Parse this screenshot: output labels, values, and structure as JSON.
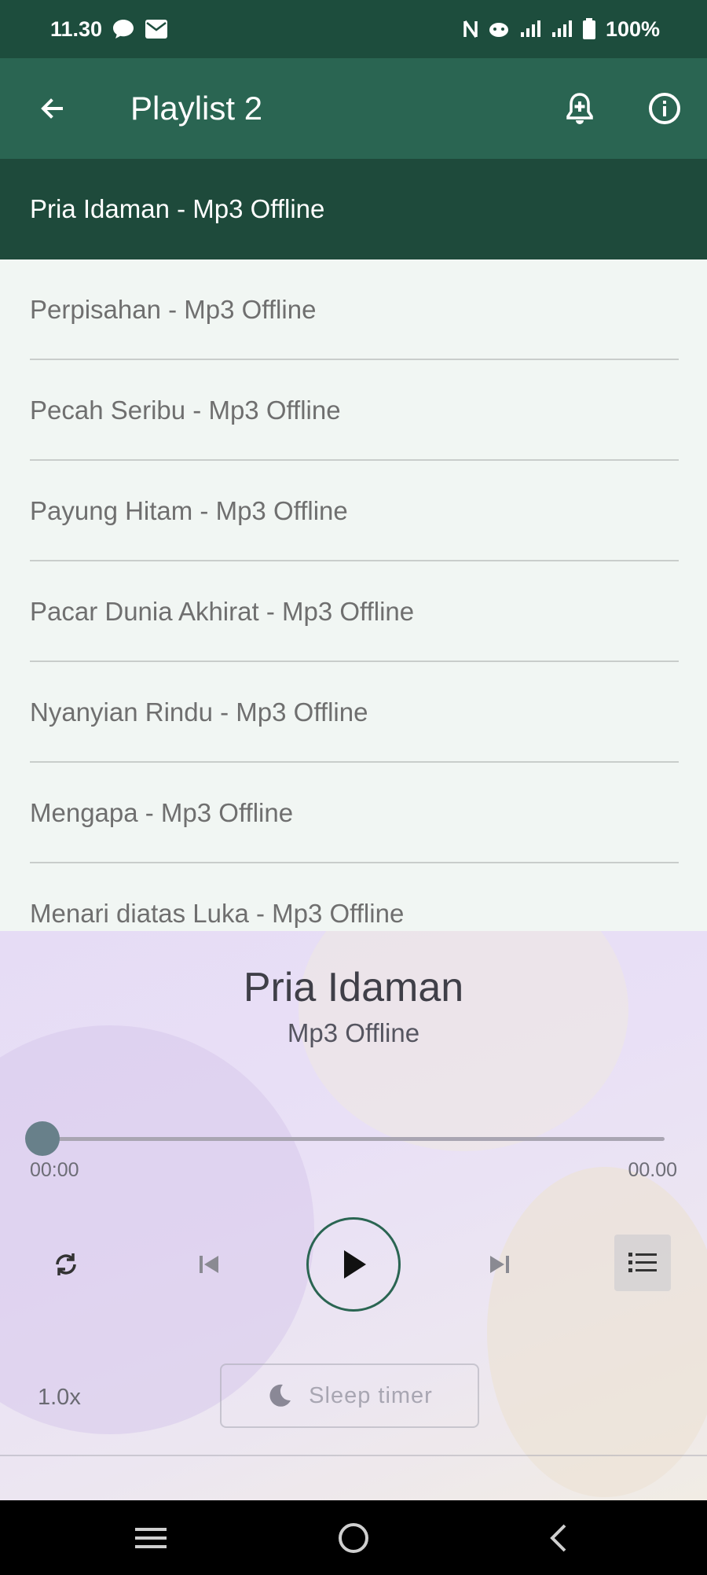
{
  "status_bar": {
    "time": "11.30",
    "battery": "100%",
    "icons": [
      "chat-bubble-icon",
      "email-icon",
      "nfc-icon",
      "mobile-data-icon",
      "signal-icon",
      "signal-icon",
      "battery-icon"
    ]
  },
  "app_bar": {
    "title": "Playlist 2",
    "icons": [
      "back-arrow-icon",
      "bell-icon",
      "info-icon"
    ]
  },
  "playlist": {
    "current": "Pria Idaman - Mp3 Offline",
    "items": [
      "Perpisahan - Mp3 Offline",
      "Pecah Seribu - Mp3 Offline",
      "Payung Hitam - Mp3 Offline",
      "Pacar Dunia Akhirat - Mp3 Offline",
      "Nyanyian Rindu - Mp3 Offline",
      "Mengapa - Mp3 Offline",
      "Menari diatas Luka - Mp3 Offline"
    ]
  },
  "player": {
    "title": "Pria Idaman",
    "subtitle": "Mp3 Offline",
    "position": "00:00",
    "duration": "00.00",
    "progress_fraction": 0,
    "speed": "1.0x",
    "sleep_timer": "Sleep timer",
    "icons": [
      "repeat-icon",
      "skip-previous-icon",
      "play-icon",
      "skip-next-icon",
      "queue-list-icon",
      "moon-icon"
    ]
  },
  "colors": {
    "status_bar": "#1d4d3d",
    "app_bar": "#2a6552",
    "current_row": "#1e4a3b",
    "list_bg": "#f1f6f3",
    "accent": "#2a6552"
  },
  "nav_bar": {
    "icons": [
      "recent-apps-icon",
      "home-icon",
      "back-icon"
    ]
  }
}
